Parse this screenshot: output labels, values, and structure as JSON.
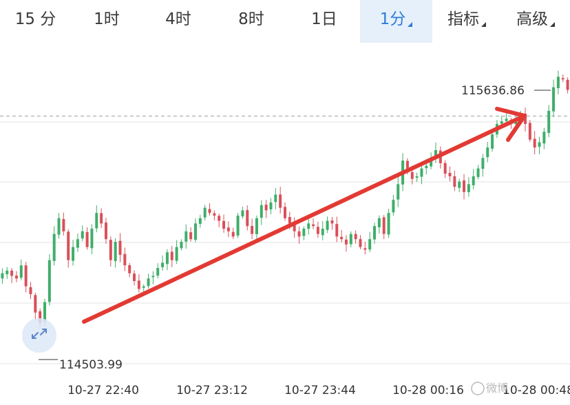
{
  "tabs": [
    {
      "label": "15 分",
      "active": false,
      "caret": false
    },
    {
      "label": "1时",
      "active": false,
      "caret": false
    },
    {
      "label": "4时",
      "active": false,
      "caret": false
    },
    {
      "label": "8时",
      "active": false,
      "caret": false
    },
    {
      "label": "1日",
      "active": false,
      "caret": false
    },
    {
      "label": "1分",
      "active": true,
      "caret": true
    },
    {
      "label": "指标",
      "active": false,
      "caret": true
    },
    {
      "label": "高级",
      "active": false,
      "caret": true
    }
  ],
  "chart_data": {
    "type": "candlestick",
    "interval": "1分",
    "high_label": "115636.86",
    "low_label": "114503.99",
    "x_ticks": [
      "10-27 22:40",
      "10-27 23:12",
      "10-27 23:44",
      "10-28 00:16",
      "10-28 00:48"
    ],
    "y_range": [
      114460,
      115730
    ],
    "current_price_line": 115450,
    "colors": {
      "up": "#3fae6a",
      "down": "#d9505a",
      "arrow": "#e23a33",
      "grid": "#e3e3e3",
      "dashed": "#9aa0a6"
    },
    "closes": [
      114850,
      114860,
      114840,
      114830,
      114880,
      114800,
      114770,
      114700,
      114660,
      114740,
      114900,
      115000,
      115060,
      115010,
      114900,
      114950,
      114980,
      115010,
      114950,
      115020,
      115080,
      115040,
      114980,
      114900,
      114970,
      114920,
      114880,
      114850,
      114820,
      114790,
      114800,
      114830,
      114840,
      114870,
      114890,
      114930,
      114900,
      114950,
      114970,
      115010,
      114980,
      115040,
      115060,
      115100,
      115080,
      115070,
      115050,
      115020,
      115010,
      114990,
      115070,
      115090,
      115030,
      115000,
      115060,
      115110,
      115090,
      115120,
      115150,
      115100,
      115060,
      115040,
      115010,
      114990,
      115020,
      115040,
      115030,
      115000,
      115020,
      115050,
      115040,
      114990,
      114980,
      114960,
      115000,
      114980,
      114950,
      114940,
      114980,
      115030,
      115060,
      115000,
      115080,
      115130,
      115190,
      115280,
      115240,
      115210,
      115220,
      115250,
      115260,
      115290,
      115320,
      115270,
      115230,
      115220,
      115180,
      115200,
      115160,
      115190,
      115220,
      115250,
      115290,
      115330,
      115380,
      115420,
      115430,
      115440,
      115420,
      115440,
      115460,
      115420,
      115360,
      115330,
      115350,
      115390,
      115470,
      115560,
      115600,
      115590,
      115550
    ]
  },
  "watermark": "微博",
  "icons": {
    "expand": "expand-icon"
  }
}
